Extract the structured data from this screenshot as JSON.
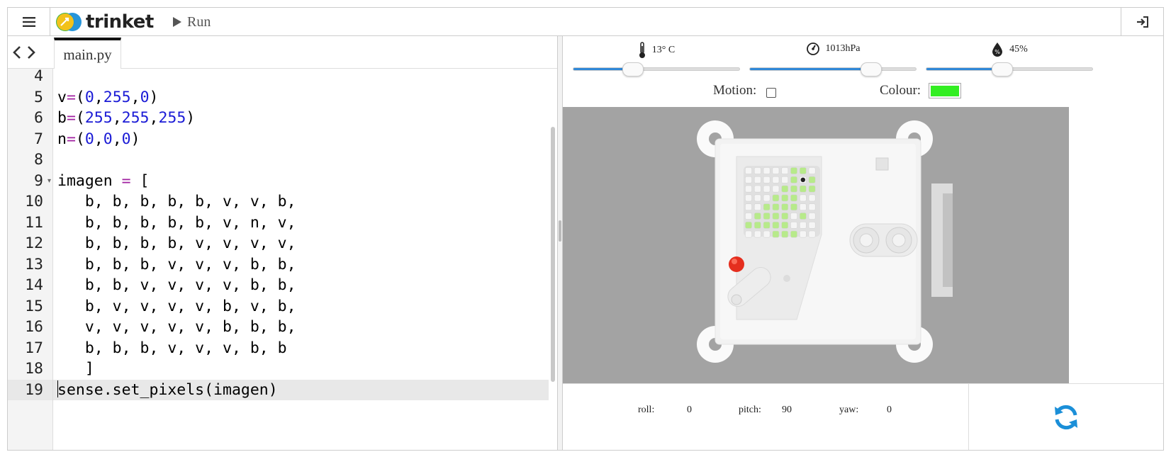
{
  "app": {
    "brand": "trinket",
    "run_label": "Run"
  },
  "editor": {
    "tab_label": "main.py",
    "lines": [
      {
        "n": "4",
        "text": ""
      },
      {
        "n": "5",
        "text": "v=(0,255,0)"
      },
      {
        "n": "6",
        "text": "b=(255,255,255)"
      },
      {
        "n": "7",
        "text": "n=(0,0,0)"
      },
      {
        "n": "8",
        "text": ""
      },
      {
        "n": "9",
        "text": "imagen = ["
      },
      {
        "n": "10",
        "text": "   b, b, b, b, b, v, v, b,"
      },
      {
        "n": "11",
        "text": "   b, b, b, b, b, v, n, v,"
      },
      {
        "n": "12",
        "text": "   b, b, b, b, v, v, v, v,"
      },
      {
        "n": "13",
        "text": "   b, b, b, v, v, v, b, b,"
      },
      {
        "n": "14",
        "text": "   b, b, v, v, v, v, b, b,"
      },
      {
        "n": "15",
        "text": "   b, v, v, v, v, b, v, b,"
      },
      {
        "n": "16",
        "text": "   v, v, v, v, v, b, b, b,"
      },
      {
        "n": "17",
        "text": "   b, b, b, v, v, v, b, b"
      },
      {
        "n": "18",
        "text": "   ]"
      },
      {
        "n": "19",
        "text": "sense.set_pixels(imagen)"
      }
    ],
    "active_line": "19"
  },
  "sensors": {
    "temperature": {
      "label": "13° C",
      "value_fraction": 0.35
    },
    "pressure": {
      "label": "1013hPa",
      "value_fraction": 0.72
    },
    "humidity": {
      "label": "45%",
      "value_fraction": 0.45
    }
  },
  "options": {
    "motion_label": "Motion:",
    "motion_checked": false,
    "colour_label": "Colour:",
    "colour_value": "#33ee22"
  },
  "led_matrix": {
    "rows": [
      "bbbbbvvb",
      "bbbbbvnv",
      "bbbbvvvv",
      "bbbvvvbb",
      "bbvvvvbb",
      "bvvvvbvb",
      "vvvvvbbb",
      "bbbvvvbb"
    ],
    "colors": {
      "v": "#b7ea8a",
      "b": "#f5f5f5",
      "n": "#222222"
    }
  },
  "imu": {
    "roll_label": "roll:",
    "roll": "0",
    "pitch_label": "pitch:",
    "pitch": "90",
    "yaw_label": "yaw:",
    "yaw": "0"
  },
  "colors": {
    "accent": "#2f88d8",
    "canvas_bg": "#a3a3a3",
    "logo_yellow": "#f2c21b",
    "logo_green": "#3cb44a",
    "logo_blue": "#1b8fd8"
  },
  "icons": {
    "menu": "hamburger-icon",
    "run": "play-icon",
    "login": "sign-in-icon",
    "temperature": "thermometer-icon",
    "pressure": "gauge-icon",
    "humidity": "droplet-icon",
    "reset": "refresh-icon"
  }
}
